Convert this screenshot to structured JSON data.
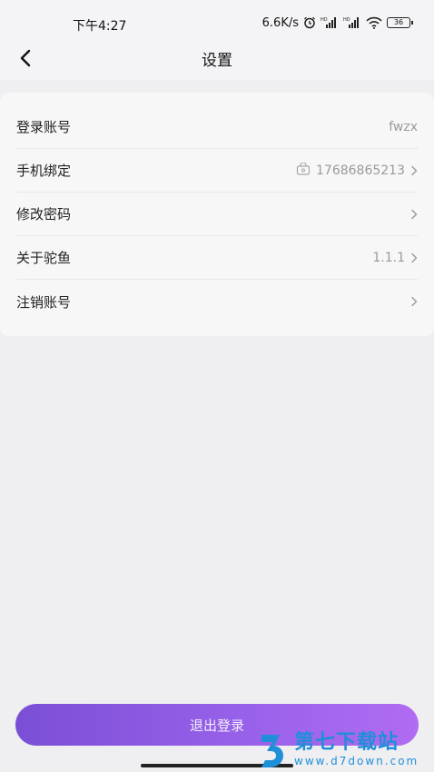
{
  "status_bar": {
    "time": "下午4:27",
    "net_speed": "6.6K/s",
    "battery": "36",
    "icons": [
      "alarm-icon",
      "hd-signal-icon",
      "hd-signal-icon",
      "wifi-icon",
      "battery-icon"
    ]
  },
  "nav": {
    "title": "设置",
    "back_icon": "chevron-left-icon"
  },
  "settings": {
    "items": [
      {
        "label": "登录账号",
        "value": "fwzx",
        "chevron": false,
        "icon": ""
      },
      {
        "label": "手机绑定",
        "value": "17686865213",
        "chevron": true,
        "icon": "lock-icon"
      },
      {
        "label": "修改密码",
        "value": "",
        "chevron": true,
        "icon": ""
      },
      {
        "label": "关于驼鱼",
        "value": "1.1.1",
        "chevron": true,
        "icon": ""
      },
      {
        "label": "注销账号",
        "value": "",
        "chevron": true,
        "icon": ""
      }
    ]
  },
  "logout": {
    "label": "退出登录"
  },
  "watermark": {
    "title": "第七下载站",
    "url": "www.d7down.com"
  },
  "colors": {
    "accent_start": "#7a4fd6",
    "accent_end": "#b06cf2",
    "background": "#efeff1",
    "card": "#f7f7f8",
    "muted_text": "#9a9a9a",
    "watermark": "#1f8fd8"
  }
}
